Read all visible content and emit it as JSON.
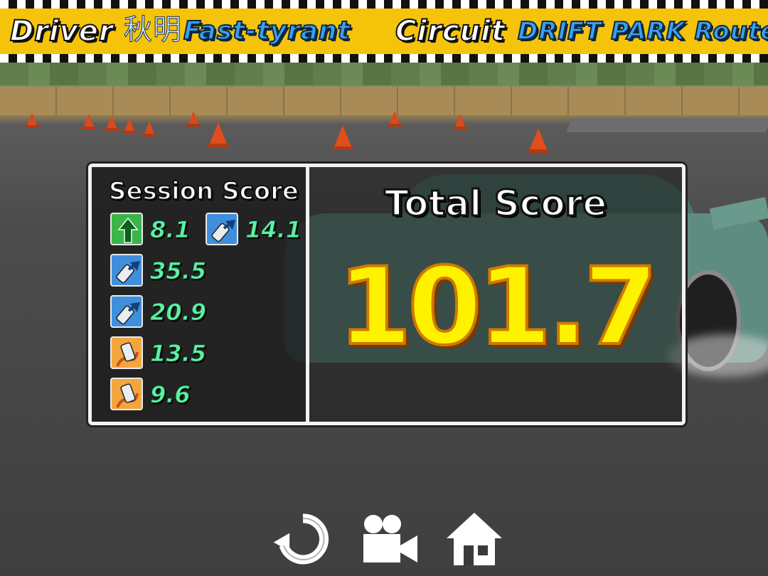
{
  "header": {
    "driver_label": "Driver",
    "driver_name_jp": "秋明",
    "driver_name": "Fast-tyrant",
    "circuit_label": "Circuit",
    "circuit_name": "DRIFT PARK Route B"
  },
  "session": {
    "title": "Session Score",
    "entries": [
      {
        "icon": "straight-arrow-icon",
        "color": "#3bb54a",
        "score": "8.1"
      },
      {
        "icon": "drift-car-blue-icon",
        "color": "#3f8fdc",
        "score": "14.1"
      },
      {
        "icon": "drift-car-blue-icon",
        "color": "#3f8fdc",
        "score": "35.5"
      },
      {
        "icon": "drift-car-blue-icon",
        "color": "#3f8fdc",
        "score": "20.9"
      },
      {
        "icon": "drift-car-orange-icon",
        "color": "#f3a640",
        "score": "13.5"
      },
      {
        "icon": "drift-car-orange-icon",
        "color": "#f3a640",
        "score": "9.6"
      }
    ]
  },
  "total": {
    "title": "Total Score",
    "value": "101.7"
  },
  "controls": {
    "retry": "retry-icon",
    "replay": "camera-icon",
    "home": "home-icon"
  },
  "colors": {
    "banner": "#f6c30b",
    "score_green": "#5ef0a2",
    "total_yellow": "#fff200"
  }
}
